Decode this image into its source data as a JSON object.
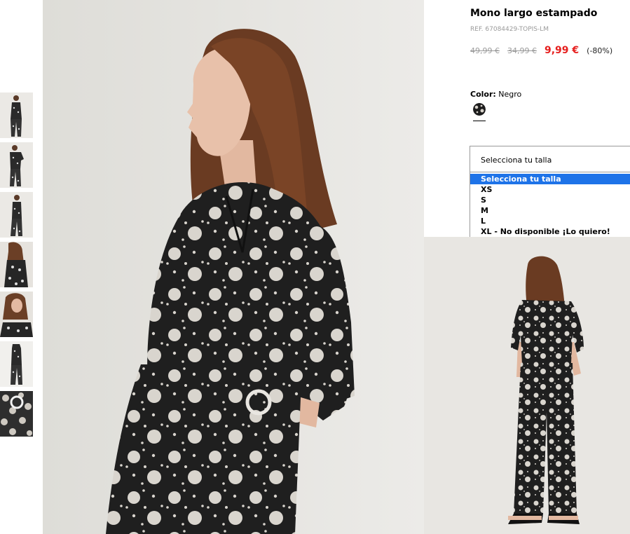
{
  "product": {
    "title": "Mono largo estampado",
    "ref": "REF. 67084429-TOPIS-LM",
    "old_price_1": "49,99 €",
    "old_price_2": "34,99 €",
    "price": "9,99 €",
    "discount": "(-80%)",
    "color_label": "Color:",
    "color_value": "Negro",
    "price_color": "#e6201f"
  },
  "size_select": {
    "value": "Selecciona tu talla",
    "options": [
      "Selecciona tu talla",
      "XS",
      "S",
      "M",
      "L",
      "XL - No disponible ¡Lo quiero!"
    ],
    "highlight_color": "#1e73e8"
  },
  "gallery": {
    "thumbnail_count": 7,
    "icons": [
      "thumbnail-image",
      "main-product-image",
      "back-view-image",
      "color-swatch-icon"
    ]
  }
}
